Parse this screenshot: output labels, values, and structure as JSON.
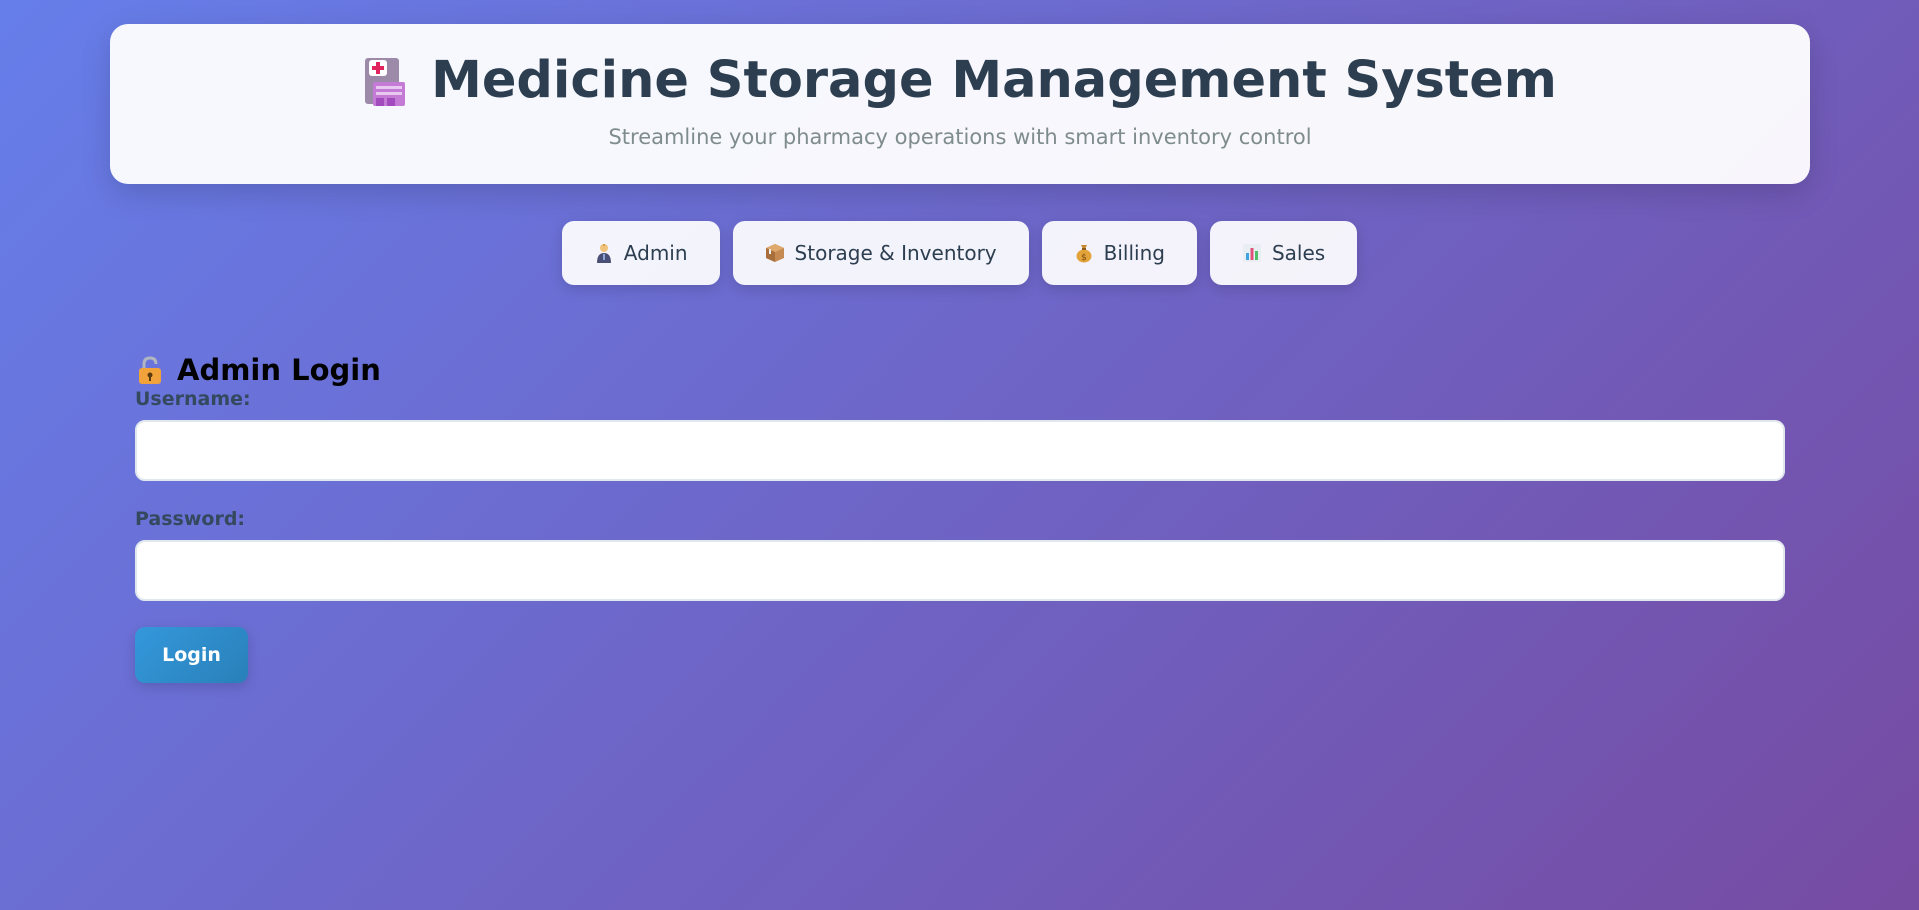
{
  "header": {
    "title": "Medicine Storage Management System",
    "subtitle": "Streamline your pharmacy operations with smart inventory control",
    "icon": "hospital-icon"
  },
  "nav": {
    "items": [
      {
        "label": "Admin",
        "icon": "admin-person-icon"
      },
      {
        "label": "Storage & Inventory",
        "icon": "package-icon"
      },
      {
        "label": "Billing",
        "icon": "money-bag-icon"
      },
      {
        "label": "Sales",
        "icon": "bar-chart-icon"
      }
    ]
  },
  "login": {
    "title": "Admin Login",
    "icon": "lock-icon",
    "username_label": "Username:",
    "username_value": "",
    "password_label": "Password:",
    "password_value": "",
    "button_label": "Login"
  },
  "colors": {
    "bg_start": "#667eea",
    "bg_end": "#764ba2",
    "title_text": "#2c3e50",
    "button": "#3498db"
  }
}
